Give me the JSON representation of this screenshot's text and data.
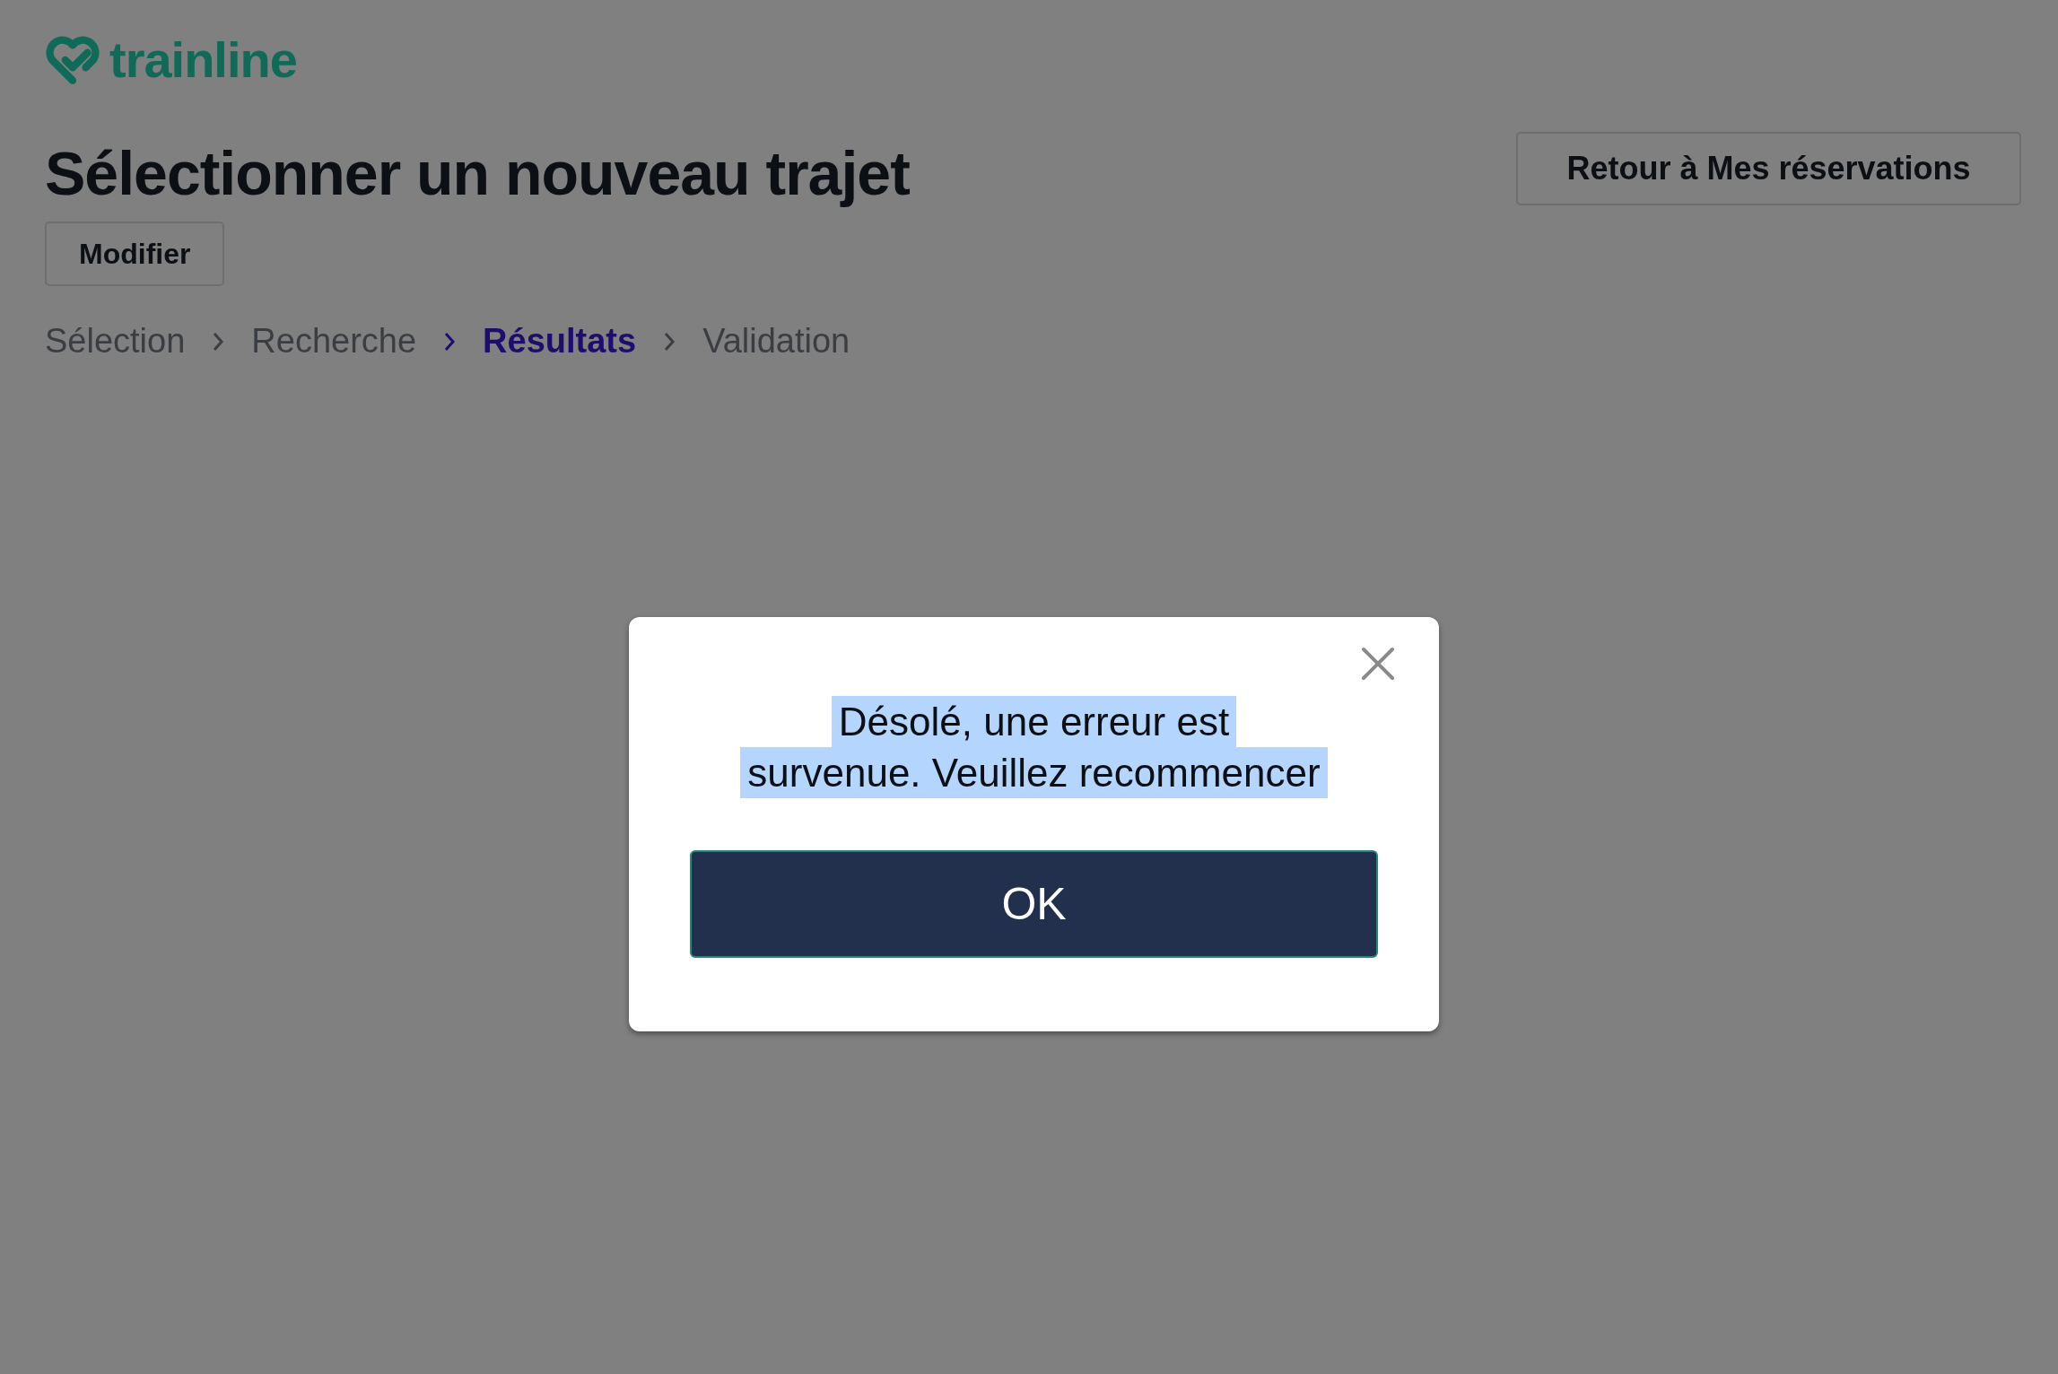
{
  "logo": {
    "text": "trainline"
  },
  "page": {
    "title": "Sélectionner un nouveau trajet",
    "back_button": "Retour à Mes réservations",
    "modify_button": "Modifier"
  },
  "breadcrumb": [
    {
      "label": "Sélection",
      "selected": false
    },
    {
      "label": "Recherche",
      "selected": false
    },
    {
      "label": "Résultats",
      "selected": true
    },
    {
      "label": "Validation",
      "selected": false
    }
  ],
  "dialog": {
    "message_lines": [
      "Désolé, une erreur est",
      "survenue. Veuillez recommencer"
    ],
    "message_highlighted": true,
    "button": "OK"
  }
}
